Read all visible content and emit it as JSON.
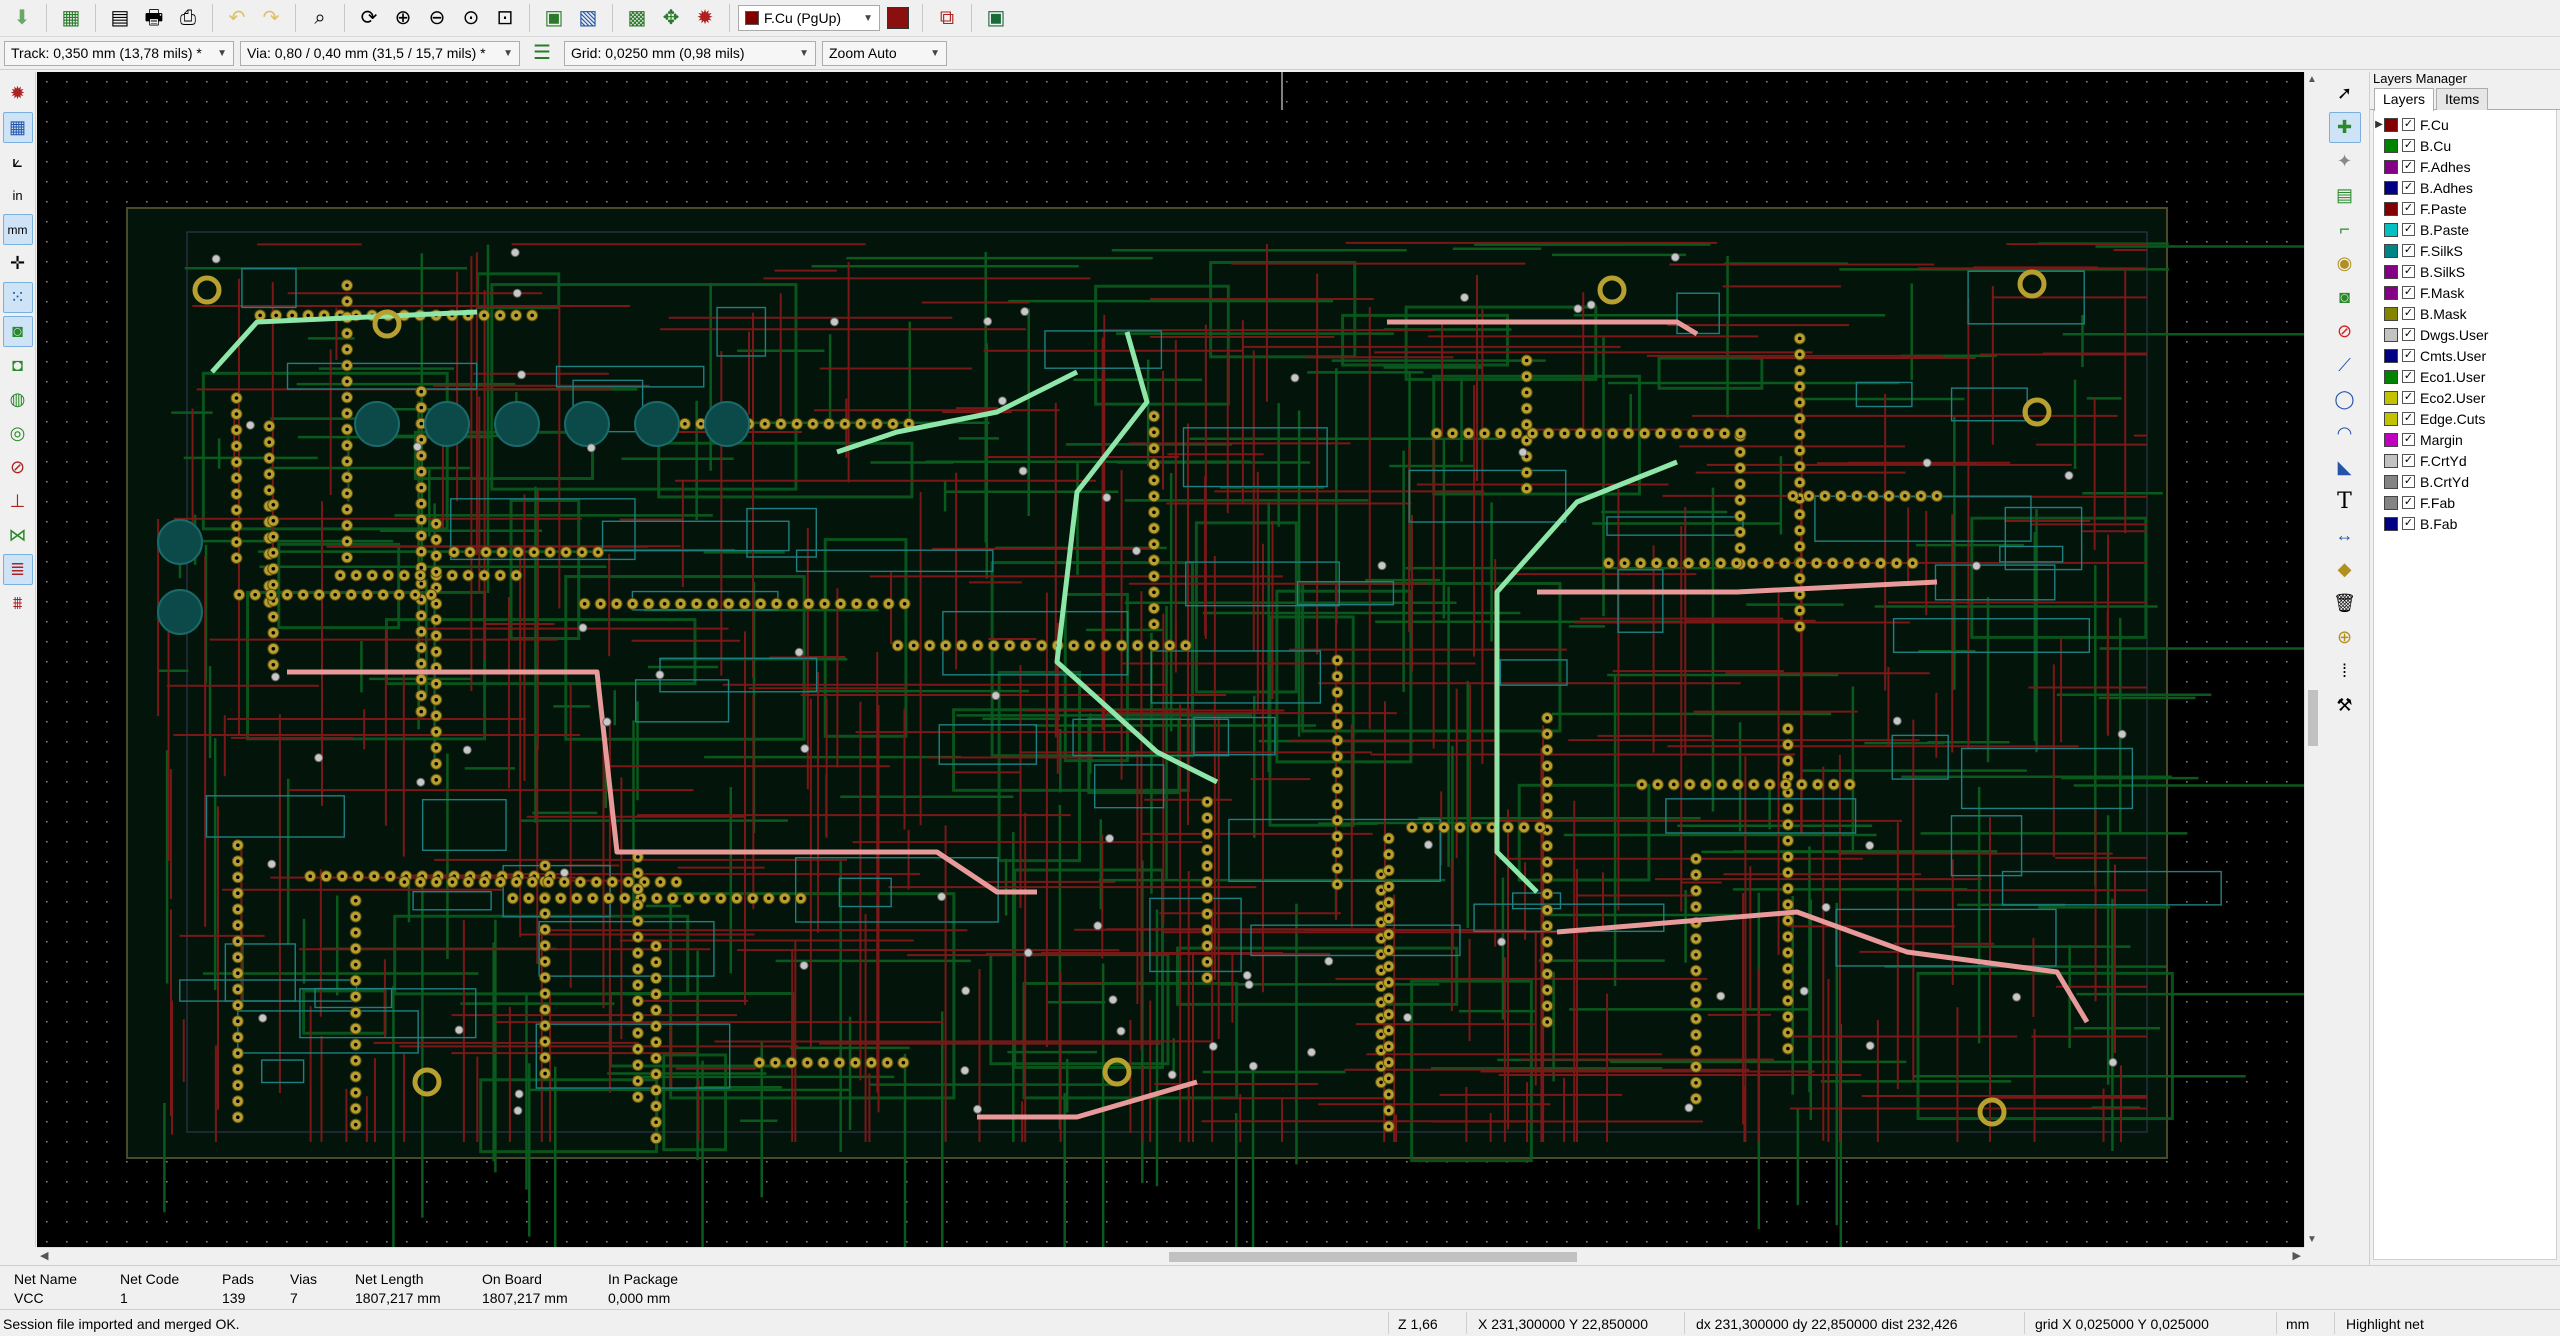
{
  "toolbar": {
    "active_layer": "F.Cu (PgUp)",
    "active_layer_color": "#800000"
  },
  "options": {
    "track": "Track: 0,350 mm (13,78 mils) *",
    "via": "Via: 0,80 / 0,40 mm (31,5 / 15,7 mils) *",
    "grid": "Grid: 0,0250 mm (0,98 mils)",
    "zoom": "Zoom Auto"
  },
  "left_tools": {
    "units_in": "in",
    "units_mm": "mm"
  },
  "layers_manager": {
    "title": "Layers Manager",
    "tabs": [
      "Layers",
      "Items"
    ],
    "layers": [
      {
        "name": "F.Cu",
        "color": "#840000"
      },
      {
        "name": "B.Cu",
        "color": "#008400"
      },
      {
        "name": "F.Adhes",
        "color": "#840084"
      },
      {
        "name": "B.Adhes",
        "color": "#000084"
      },
      {
        "name": "F.Paste",
        "color": "#840000"
      },
      {
        "name": "B.Paste",
        "color": "#00c2c2"
      },
      {
        "name": "F.SilkS",
        "color": "#008484"
      },
      {
        "name": "B.SilkS",
        "color": "#840084"
      },
      {
        "name": "F.Mask",
        "color": "#840084"
      },
      {
        "name": "B.Mask",
        "color": "#848400"
      },
      {
        "name": "Dwgs.User",
        "color": "#c2c2c2"
      },
      {
        "name": "Cmts.User",
        "color": "#000084"
      },
      {
        "name": "Eco1.User",
        "color": "#008400"
      },
      {
        "name": "Eco2.User",
        "color": "#c2c200"
      },
      {
        "name": "Edge.Cuts",
        "color": "#c2c200"
      },
      {
        "name": "Margin",
        "color": "#c200c2"
      },
      {
        "name": "F.CrtYd",
        "color": "#c2c2c2"
      },
      {
        "name": "B.CrtYd",
        "color": "#848484"
      },
      {
        "name": "F.Fab",
        "color": "#848484"
      },
      {
        "name": "B.Fab",
        "color": "#000084"
      }
    ]
  },
  "net_info": {
    "headers": [
      "Net Name",
      "Net Code",
      "Pads",
      "Vias",
      "Net Length",
      "On Board",
      "In Package"
    ],
    "values": [
      "VCC",
      "1",
      "139",
      "7",
      "1807,217 mm",
      "1807,217 mm",
      "0,000 mm"
    ]
  },
  "status": {
    "message": "Session file imported and merged OK.",
    "zoom": "Z 1,66",
    "coords": "X 231,300000  Y 22,850000",
    "delta": "dx 231,300000  dy 22,850000  dist 232,426",
    "grid": "grid X 0,025000  Y 0,025000",
    "units": "mm",
    "mode": "Highlight net"
  },
  "colors": {
    "canvas_bg": "#000000",
    "front_copper": "#7a1818",
    "back_copper": "#0a5a1e",
    "highlight_front": "#e89a9a",
    "highlight_back": "#8ee6a8",
    "pad": "#b8a030",
    "silk": "#1e8080"
  }
}
